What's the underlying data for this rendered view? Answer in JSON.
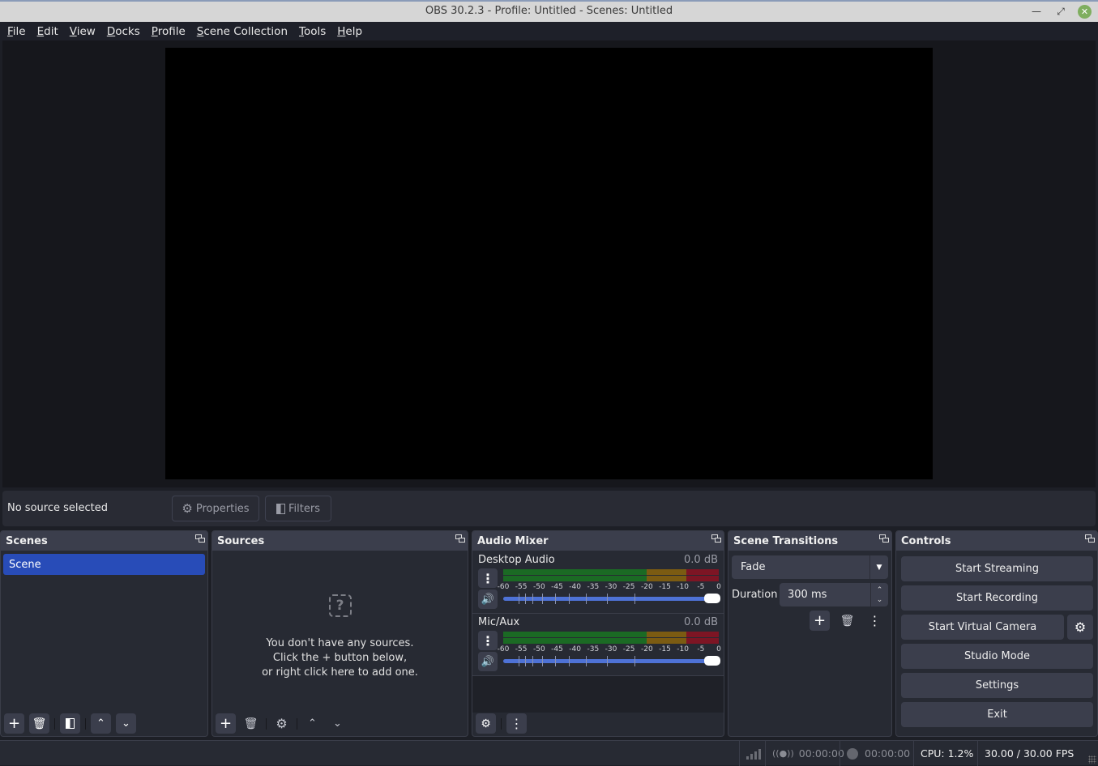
{
  "window": {
    "title": "OBS 30.2.3 - Profile: Untitled - Scenes: Untitled",
    "controls": [
      "minimize-icon",
      "restore-icon",
      "close-icon"
    ]
  },
  "menu": [
    "File",
    "Edit",
    "View",
    "Docks",
    "Profile",
    "Scene Collection",
    "Tools",
    "Help"
  ],
  "source_bar": {
    "status": "No source selected",
    "properties_label": "Properties",
    "filters_label": "Filters"
  },
  "docks": {
    "scenes": {
      "title": "Scenes",
      "items": [
        "Scene"
      ],
      "selected": "Scene"
    },
    "sources": {
      "title": "Sources",
      "empty_lines": [
        "You don't have any sources.",
        "Click the + button below,",
        "or right click here to add one."
      ]
    },
    "mixer": {
      "title": "Audio Mixer",
      "channels": [
        {
          "name": "Desktop Audio",
          "level": "0.0 dB",
          "volume_percent": 100
        },
        {
          "name": "Mic/Aux",
          "level": "0.0 dB",
          "volume_percent": 100
        }
      ],
      "meter_ticks": [
        "-60",
        "-55",
        "-50",
        "-45",
        "-40",
        "-35",
        "-30",
        "-25",
        "-20",
        "-15",
        "-10",
        "-5",
        "0"
      ],
      "colors": {
        "green": "#1b6a24",
        "yellow": "#7b5b12",
        "red": "#7d1524",
        "slider": "#4e72d6"
      }
    },
    "transitions": {
      "title": "Scene Transitions",
      "selected": "Fade",
      "duration_label": "Duration",
      "duration_value": "300 ms"
    },
    "controls": {
      "title": "Controls",
      "buttons": [
        "Start Streaming",
        "Start Recording",
        "Start Virtual Camera",
        "Studio Mode",
        "Settings",
        "Exit"
      ]
    }
  },
  "status": {
    "stream_time": "00:00:00",
    "record_time": "00:00:00",
    "cpu": "CPU: 1.2%",
    "fps": "30.00 / 30.00 FPS"
  },
  "colors": {
    "selected_scene": "#284cb8",
    "close_button": "#7fae5f"
  }
}
